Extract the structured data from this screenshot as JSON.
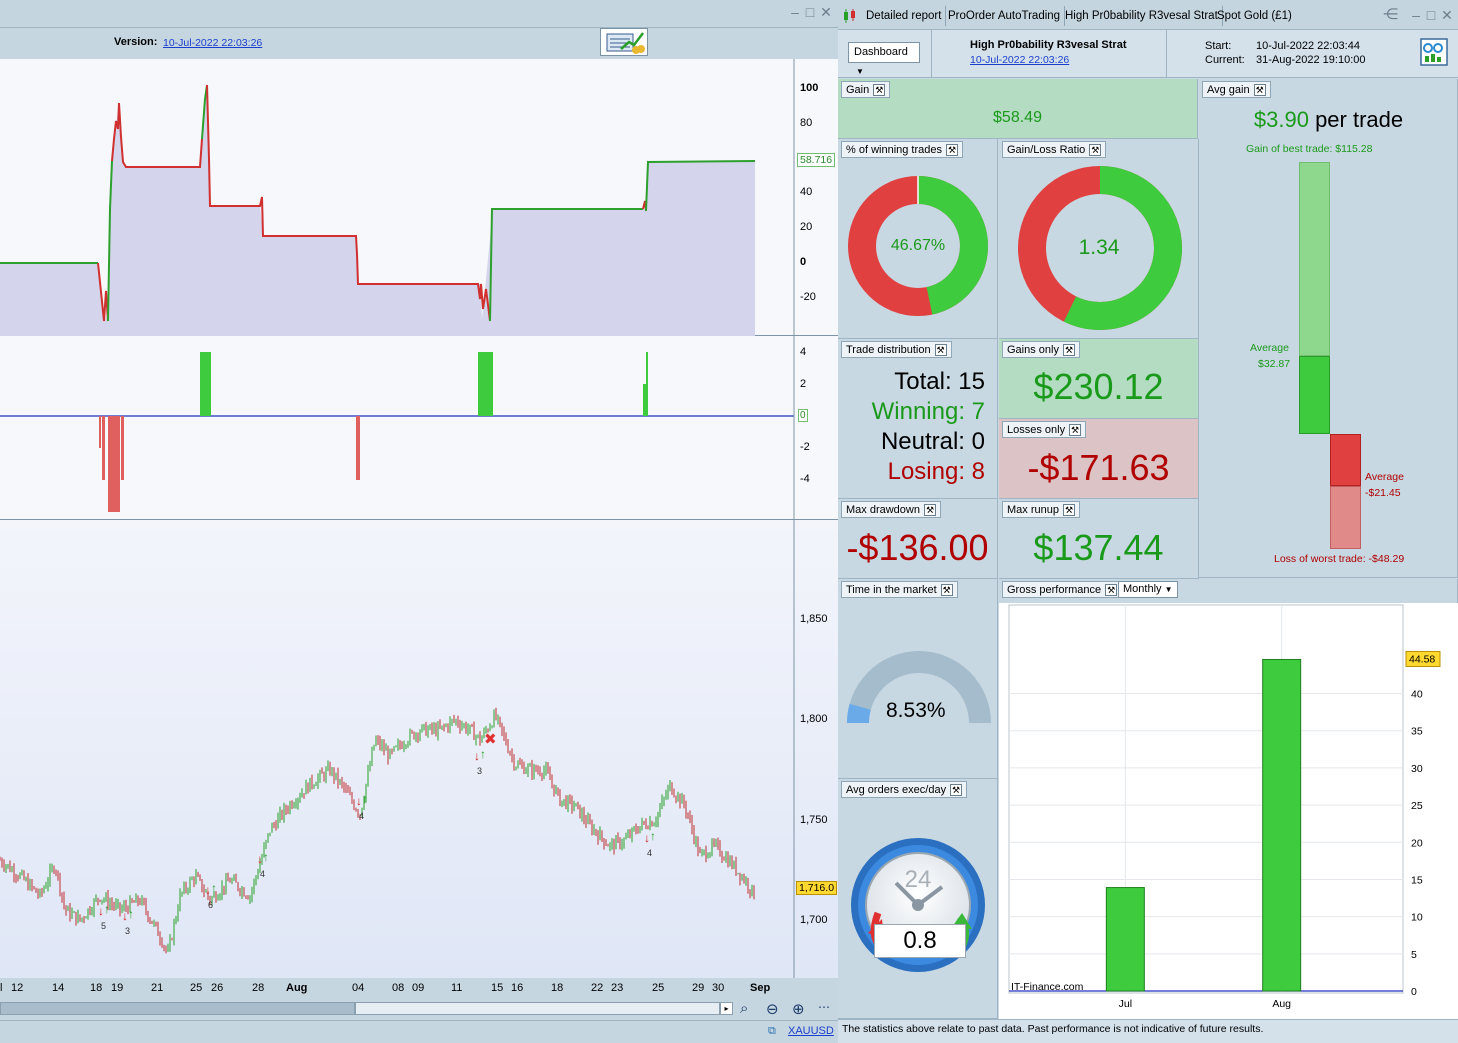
{
  "left_window": {
    "version_label": "Version:",
    "version_link": "10-Jul-2022 22:03:26",
    "panel1_axis": [
      "100",
      "80",
      "60",
      "40",
      "20",
      "0",
      "-20"
    ],
    "panel1_value_tag": "58.716",
    "panel2_axis": [
      "4",
      "2",
      "0",
      "-2",
      "-4"
    ],
    "panel3_axis": [
      "1,850",
      "1,800",
      "1,750",
      "1,700"
    ],
    "price_tag": "1,716.0",
    "x_axis": [
      "l",
      "12",
      "14",
      "18",
      "19",
      "21",
      "25",
      "26",
      "28",
      "Aug",
      "04",
      "08",
      "09",
      "11",
      "15",
      "16",
      "18",
      "22",
      "23",
      "25",
      "29",
      "30",
      "Sep"
    ],
    "trade_counts": [
      "5",
      "3",
      "6",
      "4",
      "4",
      "3",
      "4"
    ],
    "symbol": "XAUUSD"
  },
  "right_window": {
    "tabs": [
      "Detailed report",
      "ProOrder AutoTrading",
      "High Pr0bability R3vesal Strat",
      "Spot Gold (£1)"
    ],
    "dashboard_button": "Dashboard",
    "strategy_name": "High Pr0bability R3vesal Strat",
    "strategy_date": "10-Jul-2022 22:03:26",
    "start_label": "Start:",
    "start_value": "10-Jul-2022 22:03:44",
    "current_label": "Current:",
    "current_value": "31-Aug-2022 19:10:00",
    "gain": {
      "label": "Gain",
      "value": "$58.49"
    },
    "winning_pct": {
      "label": "% of winning trades",
      "value": "46.67%",
      "fraction": 0.4667
    },
    "gain_loss_ratio": {
      "label": "Gain/Loss Ratio",
      "value": "1.34",
      "fraction": 0.5726
    },
    "avg_gain": {
      "label": "Avg gain",
      "value": "$3.90",
      "unit": "per trade",
      "best_label": "Gain of best trade: $115.28",
      "avg_pos_label": "Average",
      "avg_pos_value": "$32.87",
      "avg_neg_label": "Average",
      "avg_neg_value": "-$21.45",
      "worst_label": "Loss of worst trade: -$48.29"
    },
    "trade_distribution": {
      "label": "Trade distribution",
      "total": "Total: 15",
      "winning": "Winning: 7",
      "neutral": "Neutral: 0",
      "losing": "Losing: 8"
    },
    "gains_only": {
      "label": "Gains only",
      "value": "$230.12"
    },
    "losses_only": {
      "label": "Losses only",
      "value": "-$171.63"
    },
    "max_drawdown": {
      "label": "Max drawdown",
      "value": "-$136.00"
    },
    "max_runup": {
      "label": "Max runup",
      "value": "$137.44"
    },
    "time_in_market": {
      "label": "Time in the market",
      "value": "8.53%",
      "fraction": 0.0853
    },
    "avg_orders": {
      "label": "Avg orders exec/day",
      "value": "0.8",
      "dial": "24"
    },
    "gross_performance": {
      "label": "Gross performance",
      "period": "Monthly",
      "watermark": "IT-Finance.com",
      "value_tag": "44.58"
    },
    "disclaimer": "The statistics above relate to past data. Past performance is not indicative of future results."
  },
  "colors": {
    "green": "#3ecb3e",
    "red": "#e04040",
    "dark_red": "#a00000",
    "dark_green": "#1a9a1a"
  },
  "chart_data": {
    "type": "bar",
    "title": "",
    "categories": [
      "Jul",
      "Aug"
    ],
    "values": [
      13.91,
      44.58
    ],
    "ylim": [
      0,
      48
    ],
    "y_ticks": [
      0,
      5,
      10,
      15,
      20,
      25,
      30,
      35,
      40
    ],
    "xlabel": "",
    "ylabel": "",
    "grid": true
  }
}
